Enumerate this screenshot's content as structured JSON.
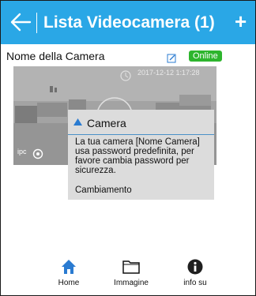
{
  "header": {
    "title": "Lista Videocamera (1)",
    "plus_label": "+"
  },
  "camera": {
    "name": "Nome della Camera",
    "status": "Online",
    "timestamp": "2017-12-12 1:17:28",
    "tag": "ipc"
  },
  "popup": {
    "title": "Camera",
    "message": "La tua camera [Nome Camera] usa password predefinita, per favore cambia password per sicurezza.",
    "action": "Cambiamento"
  },
  "nav": [
    {
      "label": "Home",
      "icon": "home-icon"
    },
    {
      "label": "Immagine",
      "icon": "folder-icon"
    },
    {
      "label": "info su",
      "icon": "info-icon"
    }
  ],
  "colors": {
    "header": "#2aa7e6",
    "online": "#2db52d",
    "nav_active": "#2a7bd1",
    "popup_line": "#4a90c8"
  }
}
